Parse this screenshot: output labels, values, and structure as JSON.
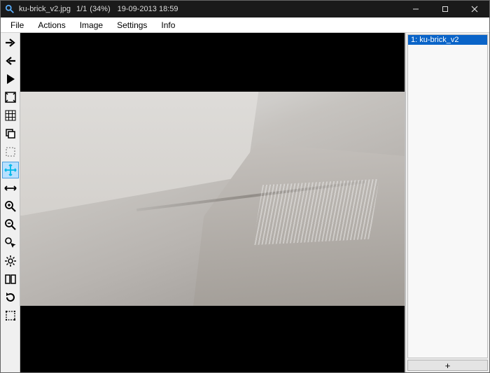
{
  "titlebar": {
    "filename": "ku-brick_v2.jpg",
    "count": "1/1",
    "zoom": "(34%)",
    "datetime": "19-09-2013 18:59"
  },
  "menubar": {
    "items": [
      "File",
      "Actions",
      "Image",
      "Settings",
      "Info"
    ]
  },
  "toolbar": {
    "next": "next-image",
    "prev": "prev-image",
    "play": "slideshow",
    "fit": "fit-window",
    "grid": "grid",
    "copy": "copy",
    "select": "selection",
    "move": "move",
    "width": "fit-width",
    "zoomin": "zoom-in",
    "zoomout": "zoom-out",
    "pointer": "pointer-zoom",
    "settings": "settings",
    "compare": "compare",
    "rotate": "rotate",
    "crop": "crop-select"
  },
  "sidebar": {
    "items": [
      {
        "label": "1: ku-brick_v2",
        "selected": true
      }
    ],
    "add_label": "+"
  },
  "colors": {
    "selection": "#0a64c8",
    "active_tool": "#00c8f0"
  }
}
